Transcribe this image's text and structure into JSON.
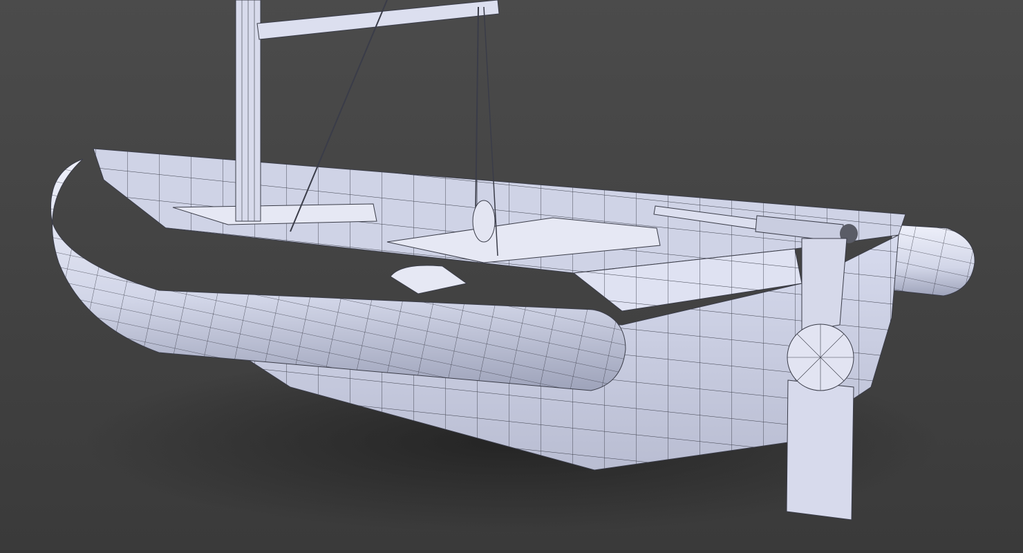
{
  "scene": {
    "subject": "wireframe-render-sailing-dinghy",
    "colors": {
      "background_top": "#4b4b4b",
      "background_bottom": "#383838",
      "model_surface": "#dcdff0",
      "model_shade": "#aeb2c6",
      "wire": "#3a3c48"
    }
  }
}
